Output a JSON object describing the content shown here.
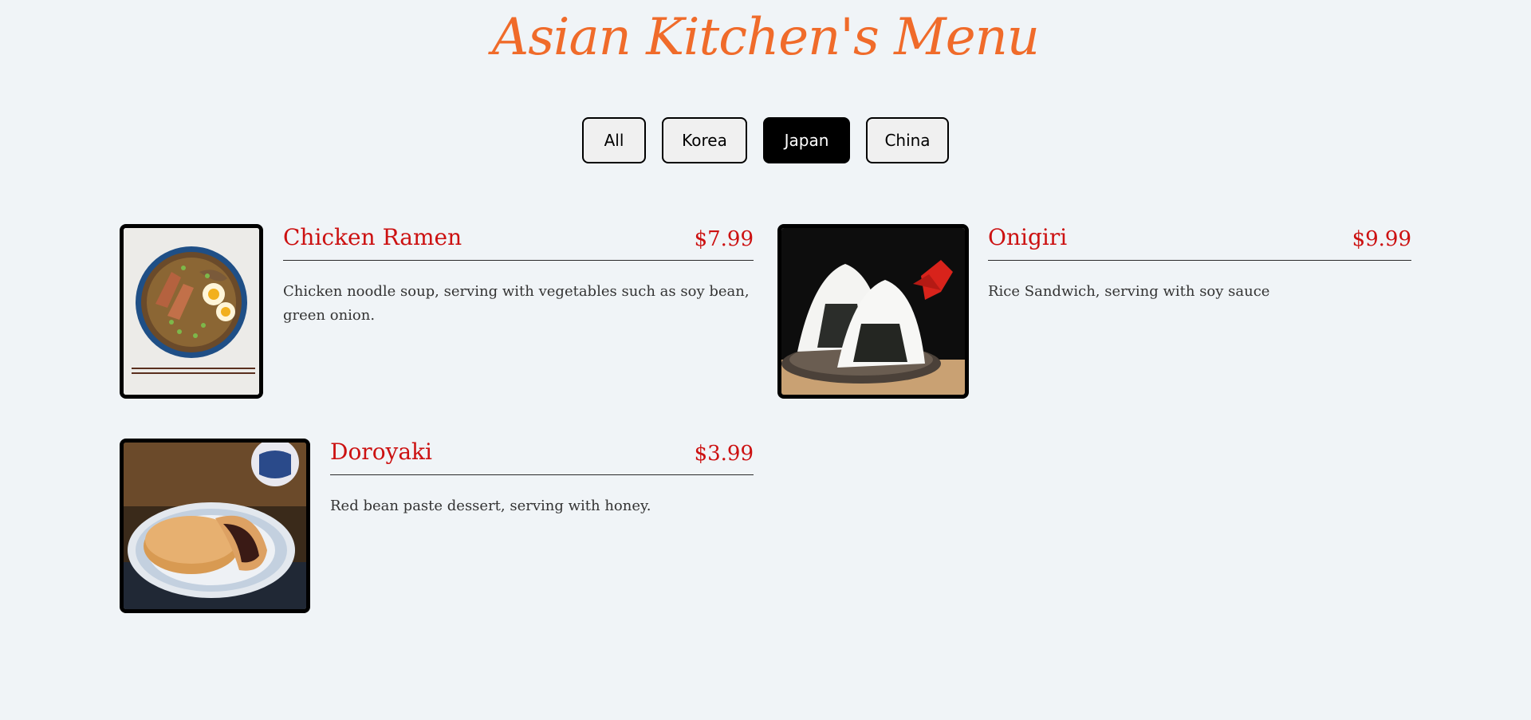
{
  "page": {
    "title": "Asian Kitchen's Menu"
  },
  "colors": {
    "title": "#f06b2a",
    "accent": "#cc1111",
    "background": "#f0f4f7"
  },
  "filters": [
    {
      "label": "All",
      "active": false
    },
    {
      "label": "Korea",
      "active": false
    },
    {
      "label": "Japan",
      "active": true
    },
    {
      "label": "China",
      "active": false
    }
  ],
  "items": [
    {
      "name": "Chicken Ramen",
      "price": "$7.99",
      "description": "Chicken noodle soup, serving with vegetables such as soy bean, green onion.",
      "image": "chicken-ramen-photo"
    },
    {
      "name": "Onigiri",
      "price": "$9.99",
      "description": "Rice Sandwich, serving with soy sauce",
      "image": "onigiri-photo"
    },
    {
      "name": "Doroyaki",
      "price": "$3.99",
      "description": "Red bean paste dessert, serving with honey.",
      "image": "doroyaki-photo"
    }
  ]
}
